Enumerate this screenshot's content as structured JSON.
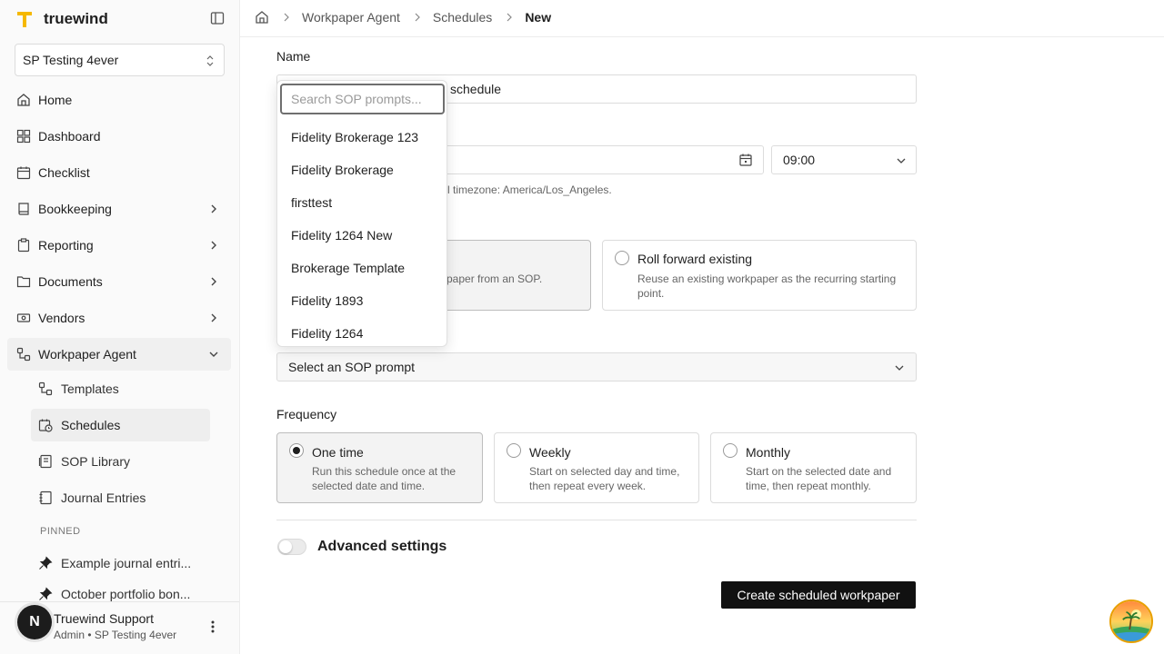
{
  "app": {
    "name": "truewind",
    "brand_color": "#f5b800"
  },
  "org_selector": {
    "value": "SP Testing 4ever"
  },
  "nav": {
    "items": [
      {
        "label": "Home",
        "icon": "home-icon"
      },
      {
        "label": "Dashboard",
        "icon": "dashboard-icon"
      },
      {
        "label": "Checklist",
        "icon": "calendar-check-icon"
      },
      {
        "label": "Bookkeeping",
        "icon": "book-icon"
      },
      {
        "label": "Reporting",
        "icon": "clipboard-icon"
      },
      {
        "label": "Documents",
        "icon": "folder-icon"
      },
      {
        "label": "Vendors",
        "icon": "money-icon"
      },
      {
        "label": "Workpaper Agent",
        "icon": "workflow-icon"
      }
    ],
    "sub_items": [
      {
        "label": "Templates",
        "icon": "workflow-icon"
      },
      {
        "label": "Schedules",
        "icon": "calendar-clock-icon"
      },
      {
        "label": "SOP Library",
        "icon": "library-icon"
      },
      {
        "label": "Journal Entries",
        "icon": "notebook-icon"
      }
    ],
    "pinned_label": "PINNED",
    "pinned": [
      {
        "label": "Example journal entri...",
        "icon": "pin-icon"
      },
      {
        "label": "October portfolio bon...",
        "icon": "pin-icon"
      }
    ]
  },
  "user": {
    "initial": "N",
    "name": "Truewind Support",
    "subtitle": "Admin • SP Testing 4ever"
  },
  "breadcrumb": {
    "items": [
      "Workpaper Agent",
      "Schedules"
    ],
    "current": "New"
  },
  "form": {
    "name_label": "Name",
    "name_value": "schedule",
    "time_value": "09:00",
    "timezone_hint": "l timezone: America/Los_Angeles.",
    "mode_options": [
      {
        "title": "",
        "desc": "kpaper from an SOP.",
        "selected": true
      },
      {
        "title": "Roll forward existing",
        "desc": "Reuse an existing workpaper as the recurring starting point.",
        "selected": false
      }
    ],
    "sop_select_value": "Select an SOP prompt",
    "frequency_label": "Frequency",
    "frequency_options": [
      {
        "title": "One time",
        "desc": "Run this schedule once at the selected date and time.",
        "selected": true
      },
      {
        "title": "Weekly",
        "desc": "Start on selected day and time, then repeat every week.",
        "selected": false
      },
      {
        "title": "Monthly",
        "desc": "Start on the selected date and time, then repeat monthly.",
        "selected": false
      }
    ],
    "advanced_label": "Advanced settings",
    "submit_label": "Create scheduled workpaper"
  },
  "sop_dropdown": {
    "search_placeholder": "Search SOP prompts...",
    "options": [
      "Fidelity Brokerage 123",
      "Fidelity Brokerage",
      "firsttest",
      "Fidelity 1264 New",
      "Brokerage Template",
      "Fidelity 1893",
      "Fidelity 1264"
    ]
  }
}
